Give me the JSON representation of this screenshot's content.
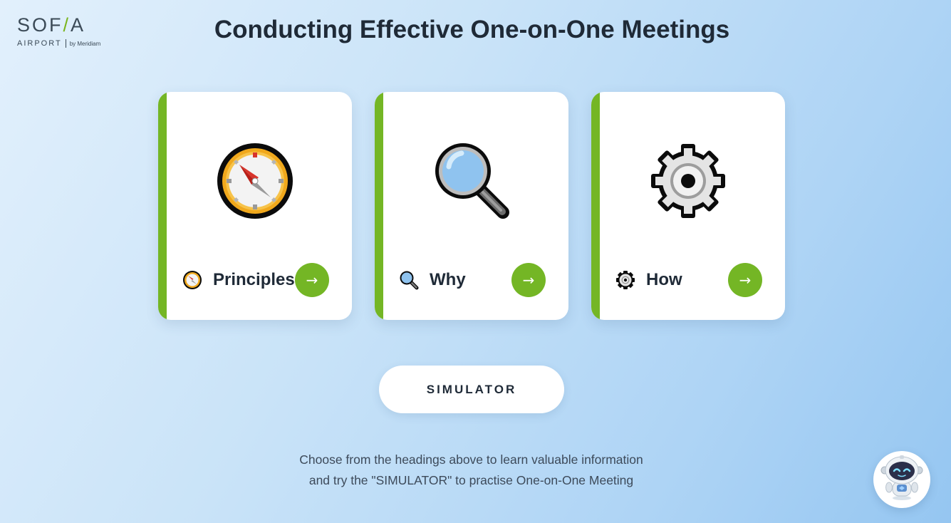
{
  "logo": {
    "brand_left": "SOF",
    "brand_right": "A",
    "sub_airport": "AIRPORT",
    "sub_by": "by Meridiam"
  },
  "page": {
    "title": "Conducting Effective One-on-One Meetings"
  },
  "cards": [
    {
      "label": "Principles",
      "icon": "compass-icon",
      "arrow": "→"
    },
    {
      "label": "Why",
      "icon": "magnifying-glass-icon",
      "arrow": "→"
    },
    {
      "label": "How",
      "icon": "gear-icon",
      "arrow": "→"
    }
  ],
  "simulator": {
    "label": "SIMULATOR"
  },
  "hint": {
    "line1": "Choose from the headings above to learn valuable information",
    "line2": "and try the \"SIMULATOR\" to practise One-on-One Meeting"
  },
  "chatbot": {
    "icon": "robot-assistant-icon"
  },
  "colors": {
    "accent_green": "#74b625",
    "title_text": "#1f2a37",
    "background_start": "#e2f0fc",
    "background_end": "#95c6f1"
  }
}
